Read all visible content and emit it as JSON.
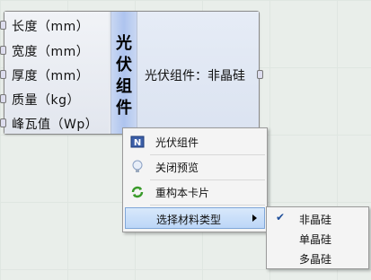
{
  "component": {
    "inputs": [
      "长度（mm）",
      "宽度（mm）",
      "厚度（mm）",
      "质量（kg）",
      "峰瓦值（Wp）"
    ],
    "name": "光伏组件",
    "output": "光伏组件：非晶硅"
  },
  "context_menu": {
    "items": [
      {
        "label": "光伏组件",
        "icon": "component-n-icon"
      },
      {
        "label": "关闭预览",
        "icon": "lightbulb-icon"
      },
      {
        "label": "重构本卡片",
        "icon": "refresh-icon"
      },
      {
        "label": "选择材料类型",
        "icon": "",
        "has_submenu": true,
        "highlighted": true
      }
    ]
  },
  "submenu": {
    "items": [
      {
        "label": "非晶硅",
        "checked": true
      },
      {
        "label": "单晶硅",
        "checked": false
      },
      {
        "label": "多晶硅",
        "checked": false
      }
    ]
  }
}
